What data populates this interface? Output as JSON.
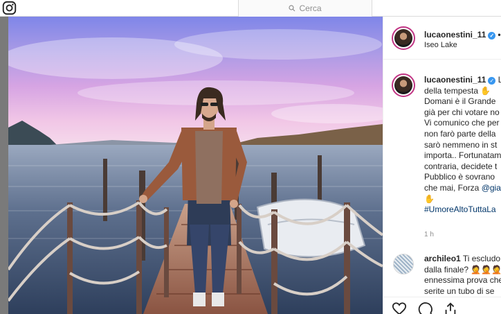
{
  "topbar": {
    "logo_icon": "instagram-logo-icon",
    "search_icon": "search-icon",
    "search_placeholder": "Cerca"
  },
  "post": {
    "author": "lucaonestini_11",
    "location": "Iseo Lake",
    "header_follow_dot": "•",
    "caption_lines": [
      "La",
      "della tempesta",
      "Domani è il Grande",
      "già per chi votare no",
      "Vi comunico che per",
      "non farò parte della",
      "sarò nemmeno in st",
      "importa.. Fortunatam",
      "contraria, decidete t",
      "Pubblico è sovrano",
      "che mai, Forza ",
      "",
      "#UmoreAltoTuttaLa"
    ],
    "caption_mention": "@gia",
    "time": "1 h"
  },
  "comment": {
    "author": "archileo1",
    "lines": [
      "Ti escludo",
      "dalla finale? ",
      "ennessima prova che",
      "serite un tubo di se"
    ]
  },
  "actions": {
    "like_icon": "heart-icon",
    "comment_icon": "comment-icon",
    "share_icon": "share-icon"
  },
  "colors": {
    "accent_link": "#003569",
    "verified": "#3897f0",
    "story_ring": "#c13584",
    "muted": "#8e8e8e"
  }
}
